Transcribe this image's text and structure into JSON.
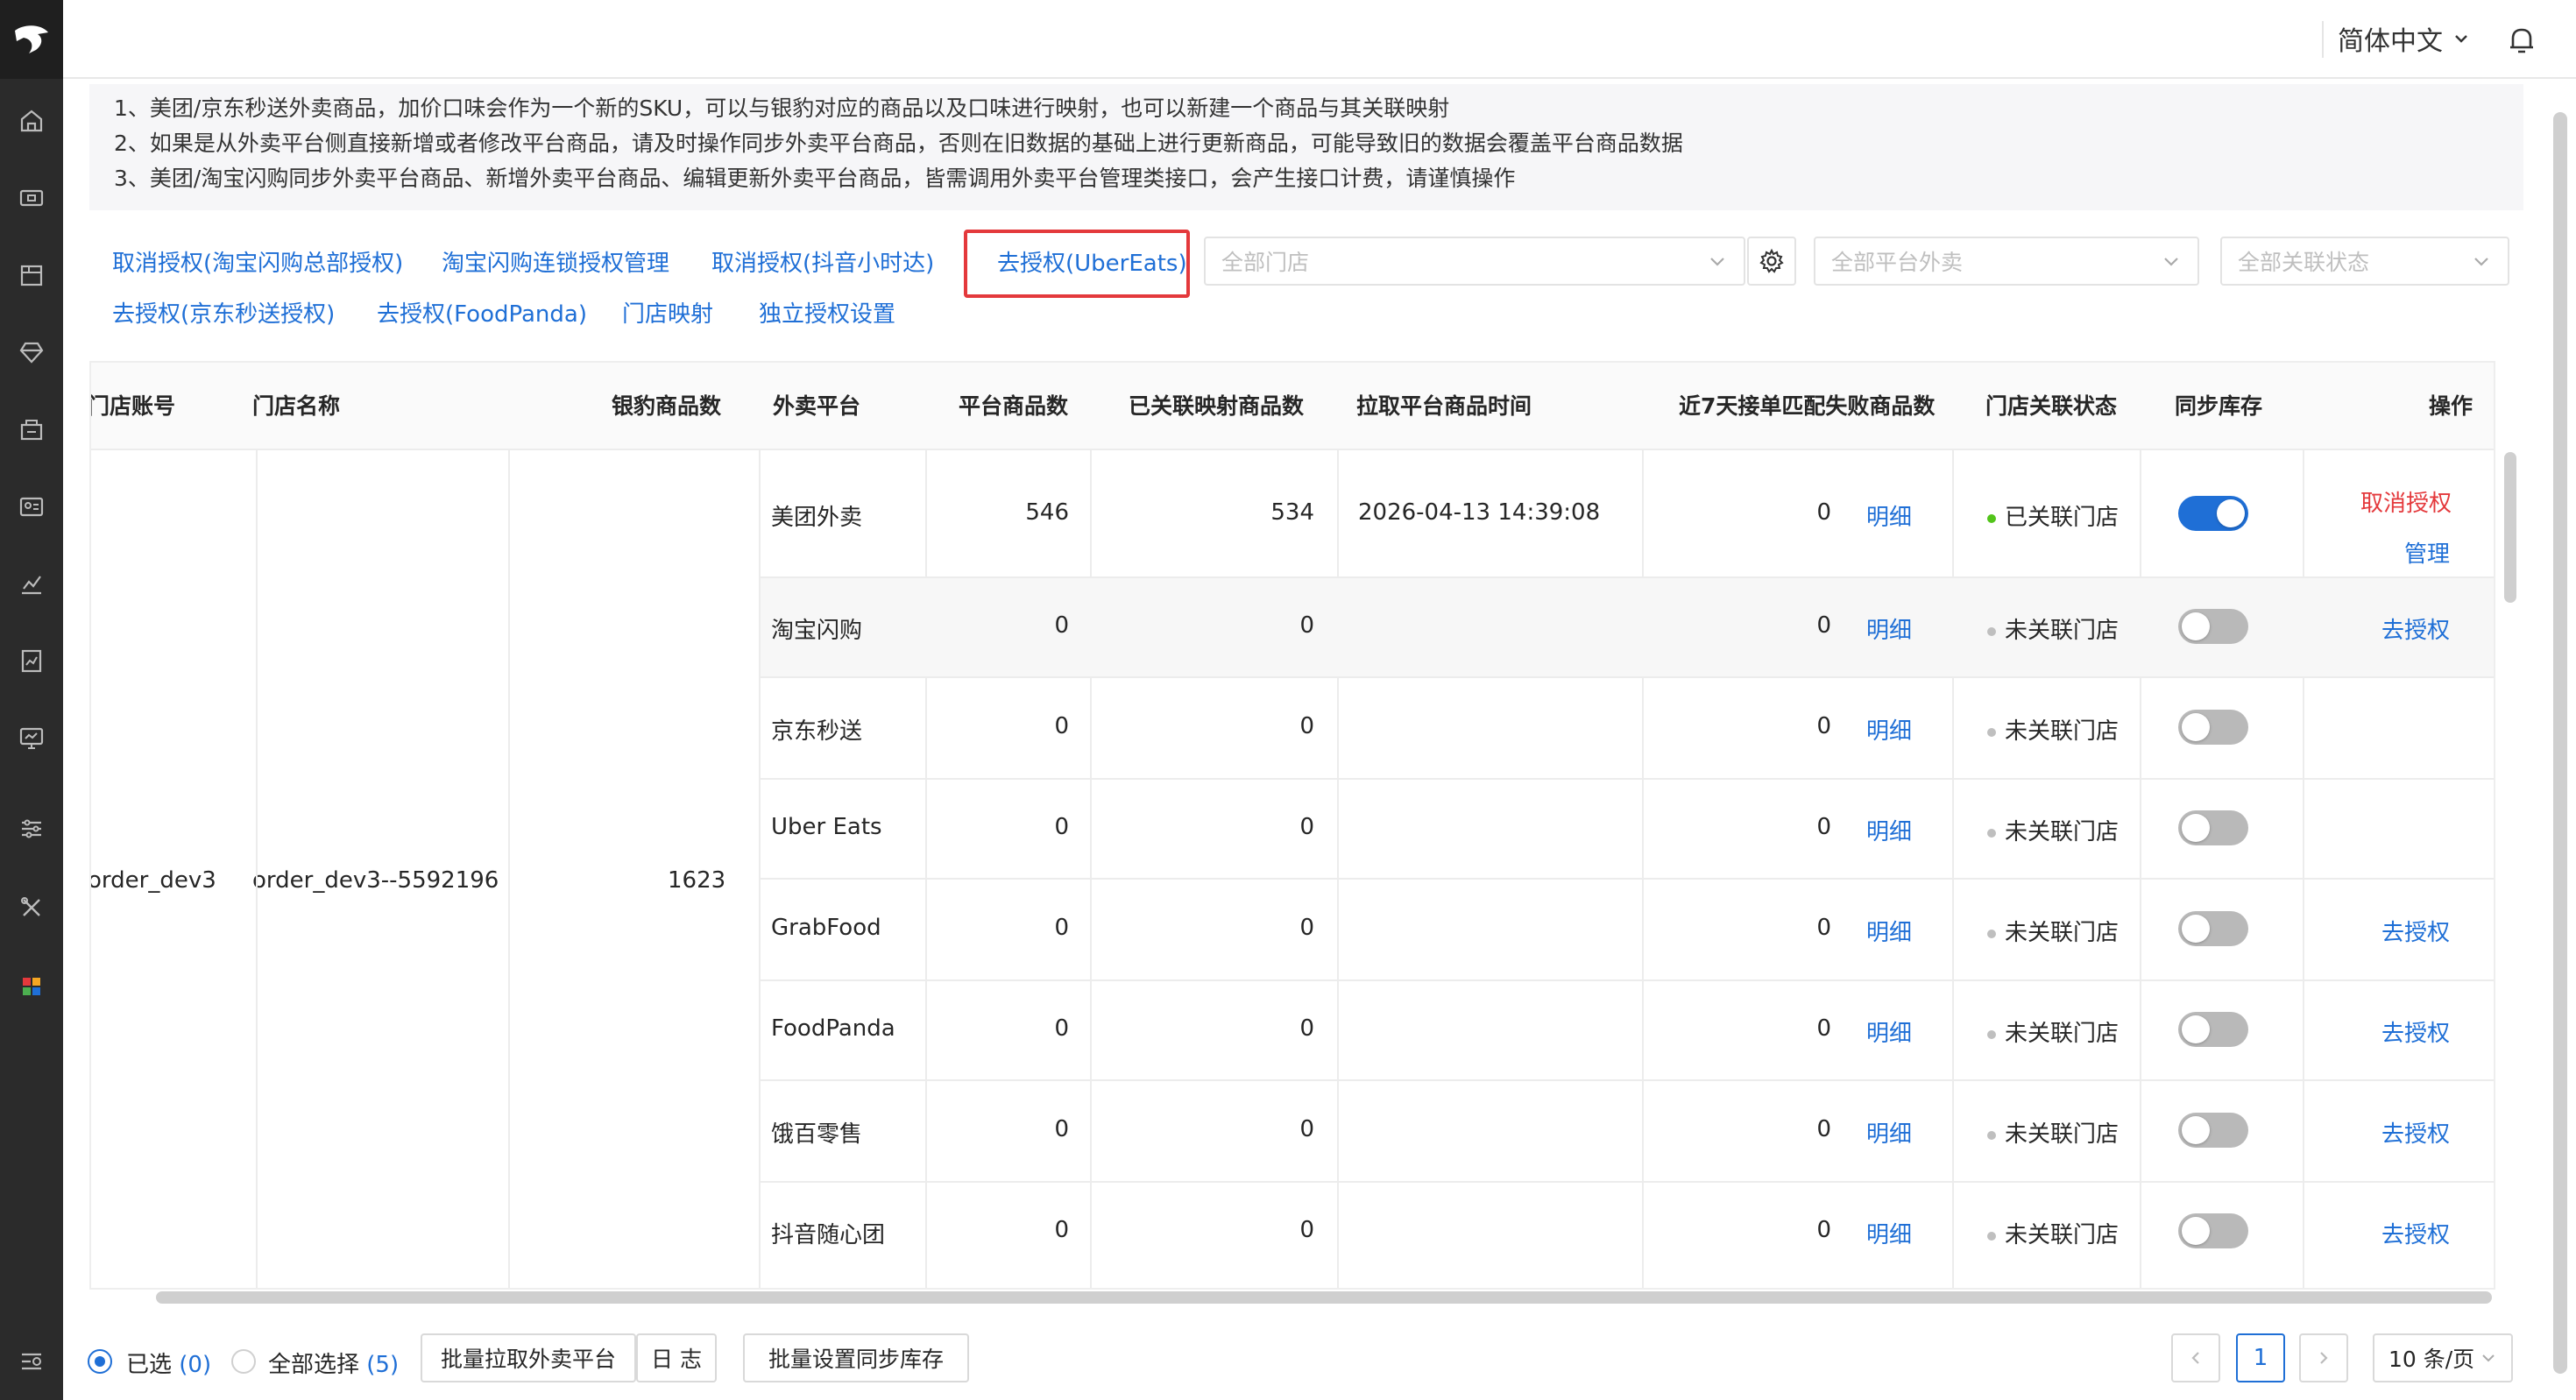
{
  "topbar": {
    "language": "简体中文"
  },
  "notice": [
    "1、美团/京东秒送外卖商品，加价口味会作为一个新的SKU，可以与银豹对应的商品以及口味进行映射，也可以新建一个商品与其关联映射",
    "2、如果是从外卖平台侧直接新增或者修改平台商品，请及时操作同步外卖平台商品，否则在旧数据的基础上进行更新商品，可能导致旧的数据会覆盖平台商品数据",
    "3、美团/淘宝闪购同步外卖平台商品、新增外卖平台商品、编辑更新外卖平台商品，皆需调用外卖平台管理类接口，会产生接口计费，请谨慎操作"
  ],
  "links": {
    "cancel_taobao_hq": "取消授权(淘宝闪购总部授权)",
    "taobao_chain": "淘宝闪购连锁授权管理",
    "cancel_douyin": "取消授权(抖音小时达)",
    "auth_ubereats": "去授权(UberEats)",
    "auth_jd": "去授权(京东秒送授权)",
    "auth_foodpanda": "去授权(FoodPanda)",
    "store_mapping": "门店映射",
    "independent_auth": "独立授权设置"
  },
  "filters": {
    "store": "全部门店",
    "platform": "全部平台外卖",
    "status": "全部关联状态"
  },
  "table": {
    "headers": {
      "account": "门店账号",
      "store_name": "门店名称",
      "yinbao_count": "银豹商品数",
      "platform": "外卖平台",
      "platform_count": "平台商品数",
      "mapped_count": "已关联映射商品数",
      "pull_time": "拉取平台商品时间",
      "fail_count": "近7天接单匹配失败商品数",
      "link_status": "门店关联状态",
      "sync_stock": "同步库存",
      "actions": "操作"
    },
    "account": "order_dev3",
    "store_name": "order_dev3--5592196",
    "yinbao_count": "1623",
    "detail_label": "明细",
    "rows": [
      {
        "platform": "美团外卖",
        "platform_count": "546",
        "mapped": "534",
        "time": "2026-04-13 14:39:08",
        "fail": "0",
        "status": "已关联门店",
        "linked": true,
        "sync": true,
        "op1": "取消授权",
        "op2": "管理"
      },
      {
        "platform": "淘宝闪购",
        "platform_count": "0",
        "mapped": "0",
        "time": "",
        "fail": "0",
        "status": "未关联门店",
        "linked": false,
        "sync": false,
        "op1": "去授权",
        "op2": ""
      },
      {
        "platform": "京东秒送",
        "platform_count": "0",
        "mapped": "0",
        "time": "",
        "fail": "0",
        "status": "未关联门店",
        "linked": false,
        "sync": false,
        "op1": "",
        "op2": ""
      },
      {
        "platform": "Uber Eats",
        "platform_count": "0",
        "mapped": "0",
        "time": "",
        "fail": "0",
        "status": "未关联门店",
        "linked": false,
        "sync": false,
        "op1": "",
        "op2": ""
      },
      {
        "platform": "GrabFood",
        "platform_count": "0",
        "mapped": "0",
        "time": "",
        "fail": "0",
        "status": "未关联门店",
        "linked": false,
        "sync": false,
        "op1": "去授权",
        "op2": ""
      },
      {
        "platform": "FoodPanda",
        "platform_count": "0",
        "mapped": "0",
        "time": "",
        "fail": "0",
        "status": "未关联门店",
        "linked": false,
        "sync": false,
        "op1": "去授权",
        "op2": ""
      },
      {
        "platform": "饿百零售",
        "platform_count": "0",
        "mapped": "0",
        "time": "",
        "fail": "0",
        "status": "未关联门店",
        "linked": false,
        "sync": false,
        "op1": "去授权",
        "op2": ""
      },
      {
        "platform": "抖音随心团",
        "platform_count": "0",
        "mapped": "0",
        "time": "",
        "fail": "0",
        "status": "未关联门店",
        "linked": false,
        "sync": false,
        "op1": "去授权",
        "op2": ""
      }
    ]
  },
  "footer": {
    "selected_label": "已选",
    "selected_count": "(0)",
    "select_all_label": "全部选择",
    "select_all_count": "(5)",
    "batch_pull": "批量拉取外卖平台",
    "log": "日 志",
    "batch_sync": "批量设置同步库存",
    "current_page": "1",
    "page_size": "10 条/页"
  },
  "colors": {
    "link": "#1f6fd6",
    "danger": "#e4393c",
    "toggle_on": "#1f6fd6",
    "toggle_off": "#b9b9b9",
    "linked_dot": "#52c41a",
    "unlinked_dot": "#bfbfbf"
  }
}
